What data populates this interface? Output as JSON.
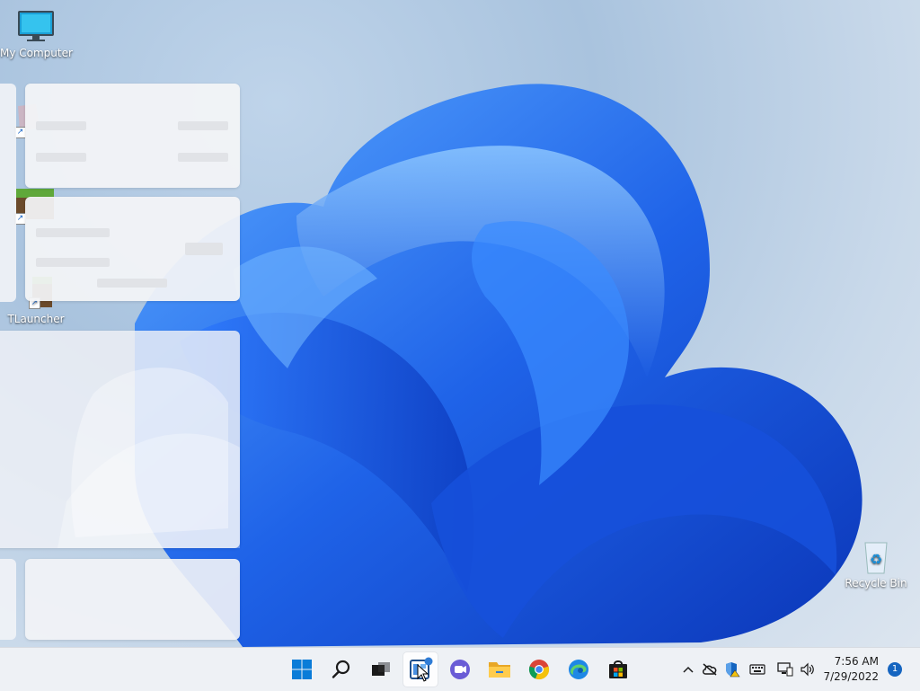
{
  "desktop": {
    "icons": [
      {
        "label": "My Computer"
      },
      {
        "label": "Recycle Bin"
      },
      {
        "label": "TLauncher"
      }
    ]
  },
  "taskbar": {
    "items": [
      {
        "name": "start",
        "icon": "windows-logo-icon"
      },
      {
        "name": "search",
        "icon": "search-icon"
      },
      {
        "name": "task-view",
        "icon": "task-view-icon"
      },
      {
        "name": "widgets",
        "icon": "widgets-icon"
      },
      {
        "name": "chat",
        "icon": "teams-chat-icon"
      },
      {
        "name": "file-explorer",
        "icon": "folder-icon"
      },
      {
        "name": "chrome",
        "icon": "chrome-icon"
      },
      {
        "name": "edge",
        "icon": "edge-icon"
      },
      {
        "name": "store",
        "icon": "store-icon"
      }
    ],
    "clock": {
      "time": "7:56 AM",
      "date": "7/29/2022"
    },
    "notification_count": "1"
  },
  "colors": {
    "accent": "#1565c0",
    "wallpaper_blue": "#1f63e8"
  }
}
